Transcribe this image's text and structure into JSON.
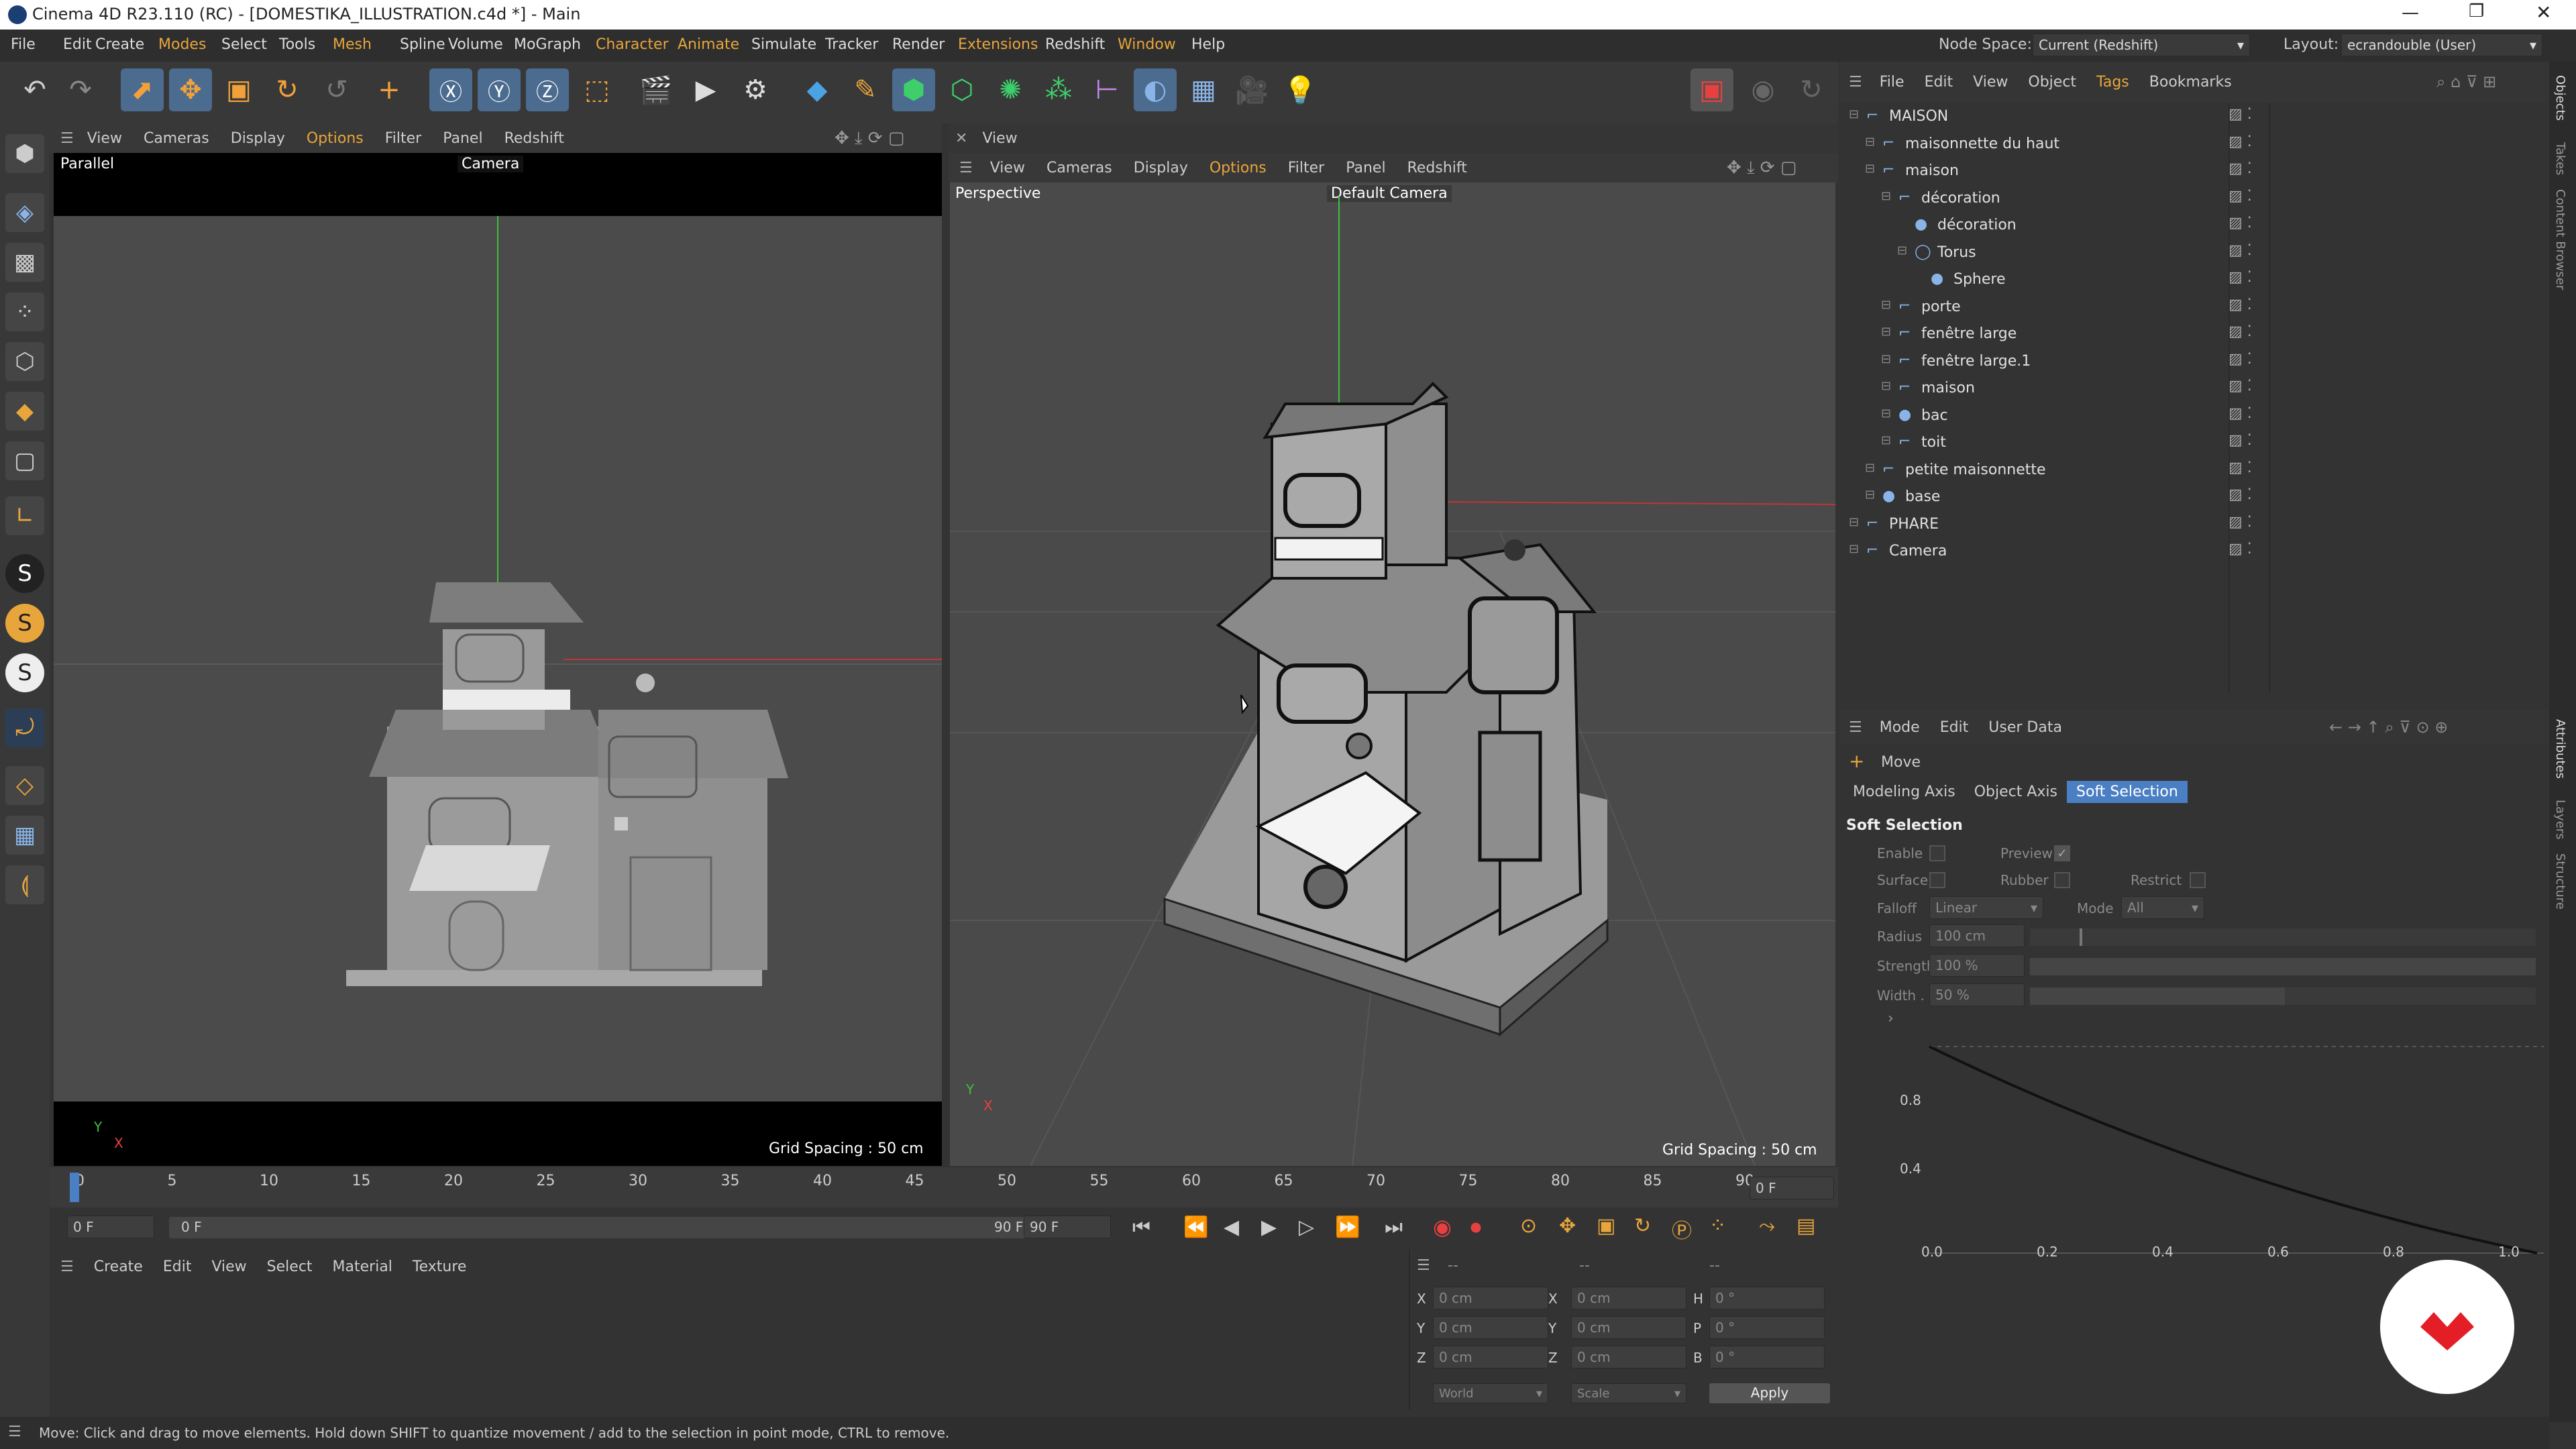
{
  "window": {
    "title": "Cinema 4D R23.110 (RC) - [DOMESTIKA_ILLUSTRATION.c4d *] - Main"
  },
  "menu": [
    {
      "label": "File",
      "hl": false
    },
    {
      "label": "Edit",
      "hl": false
    },
    {
      "label": "Create",
      "hl": false
    },
    {
      "label": "Modes",
      "hl": true
    },
    {
      "label": "Select",
      "hl": false
    },
    {
      "label": "Tools",
      "hl": false
    },
    {
      "label": "Mesh",
      "hl": true
    },
    {
      "label": "Spline",
      "hl": false
    },
    {
      "label": "Volume",
      "hl": false
    },
    {
      "label": "MoGraph",
      "hl": false
    },
    {
      "label": "Character",
      "hl": true
    },
    {
      "label": "Animate",
      "hl": true
    },
    {
      "label": "Simulate",
      "hl": false
    },
    {
      "label": "Tracker",
      "hl": false
    },
    {
      "label": "Render",
      "hl": false
    },
    {
      "label": "Extensions",
      "hl": true
    },
    {
      "label": "Redshift",
      "hl": false
    },
    {
      "label": "Window",
      "hl": true
    },
    {
      "label": "Help",
      "hl": false
    }
  ],
  "node_space": {
    "label": "Node Space:",
    "value": "Current (Redshift)"
  },
  "layout": {
    "label": "Layout:",
    "value": "ecrandouble (User)"
  },
  "left_view": {
    "menu": [
      "View",
      "Cameras",
      "Display",
      "Options",
      "Filter",
      "Panel",
      "Redshift"
    ],
    "projection": "Parallel",
    "camera": "Camera",
    "grid_spacing": "Grid Spacing : 50 cm"
  },
  "right_view": {
    "title": "View",
    "menu": [
      "View",
      "Cameras",
      "Display",
      "Options",
      "Filter",
      "Panel",
      "Redshift"
    ],
    "projection": "Perspective",
    "camera": "Default Camera",
    "grid_spacing": "Grid Spacing : 50 cm"
  },
  "objects_panel": {
    "menu": [
      "File",
      "Edit",
      "View",
      "Object",
      "Tags",
      "Bookmarks"
    ],
    "items": [
      {
        "name": "MAISON",
        "depth": 0
      },
      {
        "name": "maisonnette du haut",
        "depth": 1
      },
      {
        "name": "maison",
        "depth": 1
      },
      {
        "name": "décoration",
        "depth": 2
      },
      {
        "name": "décoration",
        "depth": 3
      },
      {
        "name": "Torus",
        "depth": 3
      },
      {
        "name": "Sphere",
        "depth": 4
      },
      {
        "name": "porte",
        "depth": 2
      },
      {
        "name": "fenêtre large",
        "depth": 2
      },
      {
        "name": "fenêtre large.1",
        "depth": 2
      },
      {
        "name": "maison",
        "depth": 2
      },
      {
        "name": "bac",
        "depth": 2
      },
      {
        "name": "toit",
        "depth": 2
      },
      {
        "name": "petite maisonnette",
        "depth": 1
      },
      {
        "name": "base",
        "depth": 1
      },
      {
        "name": "PHARE",
        "depth": 0
      },
      {
        "name": "Camera",
        "depth": 0
      }
    ]
  },
  "side_tabs": {
    "top": [
      "Objects",
      "Takes",
      "Content Browser"
    ],
    "bottom": [
      "Attributes",
      "Layers",
      "Structure"
    ]
  },
  "attributes": {
    "menu": [
      "Mode",
      "Edit",
      "User Data"
    ],
    "tool": "Move",
    "tabs": [
      "Modeling Axis",
      "Object Axis",
      "Soft Selection"
    ],
    "active_tab": "Soft Selection",
    "section": "Soft Selection",
    "enable": "Enable",
    "preview": "Preview",
    "surface": "Surface",
    "rubber": "Rubber",
    "restrict": "Restrict",
    "falloff_label": "Falloff",
    "falloff_value": "Linear",
    "mode_label": "Mode",
    "mode_value": "All",
    "radius_label": "Radius",
    "radius_value": "100 cm",
    "strength_label": "Strength",
    "strength_value": "100 %",
    "width_label": "Width . .",
    "width_value": "50 %",
    "graph_y_ticks": [
      "0.8",
      "0.4",
      "0.0"
    ],
    "graph_x_ticks": [
      "0.2",
      "0.4",
      "0.6",
      "0.8",
      "1.0"
    ]
  },
  "timeline": {
    "ticks": [
      "0",
      "5",
      "10",
      "15",
      "20",
      "25",
      "30",
      "35",
      "40",
      "45",
      "50",
      "55",
      "60",
      "65",
      "70",
      "75",
      "80",
      "85",
      "90"
    ],
    "current_frame": "0 F",
    "start": "0 F",
    "range_start": "0 F",
    "range_end": "90 F",
    "end": "90 F"
  },
  "material_manager": {
    "menu": [
      "Create",
      "Edit",
      "View",
      "Select",
      "Material",
      "Texture"
    ]
  },
  "coordinates": {
    "header": [
      "--",
      "--",
      "--"
    ],
    "rows": [
      {
        "a": "X",
        "av": "0 cm",
        "b": "X",
        "bv": "0 cm",
        "c": "H",
        "cv": "0 °"
      },
      {
        "a": "Y",
        "av": "0 cm",
        "b": "Y",
        "bv": "0 cm",
        "c": "P",
        "cv": "0 °"
      },
      {
        "a": "Z",
        "av": "0 cm",
        "b": "Z",
        "bv": "0 cm",
        "c": "B",
        "cv": "0 °"
      }
    ],
    "world": "World",
    "scale": "Scale",
    "apply": "Apply"
  },
  "status": "Move: Click and drag to move elements. Hold down SHIFT to quantize movement / add to the selection in point mode, CTRL to remove.",
  "colors": {
    "accent": "#e8a53b",
    "selection": "#4a7fc4",
    "brand": "#e41e26"
  }
}
